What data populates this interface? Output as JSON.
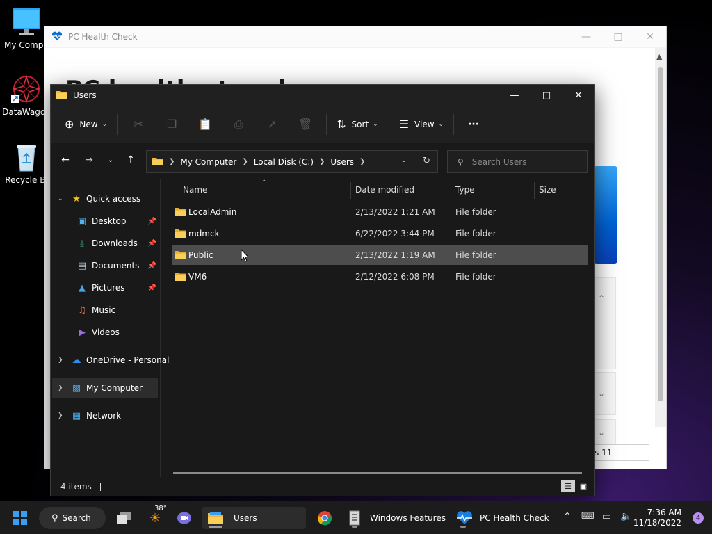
{
  "desktop": {
    "icons": [
      {
        "label": "My Compu"
      },
      {
        "label": "DataWagon"
      },
      {
        "label": "Recycle Bi"
      }
    ]
  },
  "health_window": {
    "title": "PC Health Check",
    "heading": "PC health at a glance",
    "windows_button": "s 11"
  },
  "explorer": {
    "title": "Users",
    "toolbar": {
      "new_label": "New",
      "sort_label": "Sort",
      "view_label": "View",
      "more_label": "···"
    },
    "address": {
      "segments": [
        "My Computer",
        "Local Disk (C:)",
        "Users"
      ]
    },
    "search": {
      "placeholder": "Search Users"
    },
    "nav": {
      "quick_access": "Quick access",
      "pinned": [
        "Desktop",
        "Downloads",
        "Documents",
        "Pictures"
      ],
      "unpinned": [
        "Music",
        "Videos"
      ],
      "onedrive": "OneDrive - Personal",
      "my_computer": "My Computer",
      "network": "Network"
    },
    "columns": {
      "name": "Name",
      "date": "Date modified",
      "type": "Type",
      "size": "Size"
    },
    "files": [
      {
        "name": "LocalAdmin",
        "date": "2/13/2022 1:21 AM",
        "type": "File folder"
      },
      {
        "name": "mdmck",
        "date": "6/22/2022 3:44 PM",
        "type": "File folder"
      },
      {
        "name": "Public",
        "date": "2/13/2022 1:19 AM",
        "type": "File folder"
      },
      {
        "name": "VM6",
        "date": "2/12/2022 6:08 PM",
        "type": "File folder"
      }
    ],
    "status": {
      "item_count": "4 items"
    }
  },
  "taskbar": {
    "search_label": "Search",
    "weather_temp": "38°",
    "apps": [
      {
        "label": "Users"
      },
      {
        "label": "Windows Features"
      },
      {
        "label": "PC Health Check"
      }
    ],
    "clock": {
      "time": "7:36 AM",
      "date": "11/18/2022"
    },
    "notification_count": "4"
  }
}
